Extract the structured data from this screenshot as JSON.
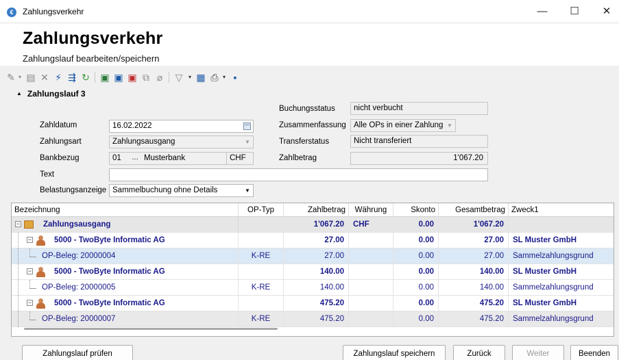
{
  "window": {
    "title": "Zahlungsverkehr",
    "min": "—",
    "max": "☐",
    "close": "✕"
  },
  "header": {
    "title": "Zahlungsverkehr",
    "subtitle": "Zahlungslauf bearbeiten/speichern"
  },
  "toolbar": {
    "icons": [
      "new-icon",
      "edit-icon",
      "delete-icon",
      "flash-icon",
      "split-icon",
      "refresh-icon",
      "export-icon",
      "export2-icon",
      "export-red-icon",
      "copy-icon",
      "erase-icon",
      "filter-icon",
      "filter-dropdown-icon",
      "doc-icon",
      "print-icon",
      "print-dropdown-icon",
      "save-icon"
    ]
  },
  "group": {
    "title": "Zahlungslauf 3"
  },
  "form": {
    "zahldatum_label": "Zahldatum",
    "zahldatum": "16.02.2022",
    "zahlungsart_label": "Zahlungsart",
    "zahlungsart": "Zahlungsausgang",
    "bankbezug_label": "Bankbezug",
    "bank_nr": "01",
    "bank_btn": "...",
    "bank_name": "Musterbank",
    "bank_cur": "CHF",
    "text_label": "Text",
    "text": "",
    "belastung_label": "Belastungsanzeige",
    "belastung": "Sammelbuchung ohne Details",
    "buchungsstatus_label": "Buchungsstatus",
    "buchungsstatus": "nicht verbucht",
    "zusammenfassung_label": "Zusammenfassung",
    "zusammenfassung": "Alle OPs in einer Zahlung",
    "transferstatus_label": "Transferstatus",
    "transferstatus": "Nicht transferiert",
    "zahlbetrag_label": "Zahlbetrag",
    "zahlbetrag": "1'067.20"
  },
  "grid": {
    "headers": {
      "bezeichnung": "Bezeichnung",
      "optyp": "OP-Typ",
      "zahlbetrag": "Zahlbetrag",
      "waehrung": "Währung",
      "skonto": "Skonto",
      "gesamt": "Gesamtbetrag",
      "zweck": "Zweck1"
    },
    "total": {
      "name": "Zahlungsausgang",
      "zahlbetrag": "1'067.20",
      "waehrung": "CHF",
      "skonto": "0.00",
      "gesamt": "1'067.20"
    },
    "rows": [
      {
        "name": "5000 - TwoByte Informatic AG",
        "zahlbetrag": "27.00",
        "skonto": "0.00",
        "gesamt": "27.00",
        "zweck": "SL Muster GmbH"
      },
      {
        "name": "OP-Beleg: 20000004",
        "optyp": "K-RE",
        "zahlbetrag": "27.00",
        "skonto": "0.00",
        "gesamt": "27.00",
        "zweck": "Sammelzahlungsgrund"
      },
      {
        "name": "5000 - TwoByte Informatic AG",
        "zahlbetrag": "140.00",
        "skonto": "0.00",
        "gesamt": "140.00",
        "zweck": "SL Muster GmbH"
      },
      {
        "name": "OP-Beleg: 20000005",
        "optyp": "K-RE",
        "zahlbetrag": "140.00",
        "skonto": "0.00",
        "gesamt": "140.00",
        "zweck": "Sammelzahlungsgrund"
      },
      {
        "name": "5000 - TwoByte Informatic AG",
        "zahlbetrag": "475.20",
        "skonto": "0.00",
        "gesamt": "475.20",
        "zweck": "SL Muster GmbH"
      },
      {
        "name": "OP-Beleg: 20000007",
        "optyp": "K-RE",
        "zahlbetrag": "475.20",
        "skonto": "0.00",
        "gesamt": "475.20",
        "zweck": "Sammelzahlungsgrund"
      }
    ]
  },
  "buttons": {
    "pruefen": "Zahlungslauf prüfen",
    "speichern": "Zahlungslauf speichern",
    "zurueck": "Zurück",
    "weiter": "Weiter",
    "beenden": "Beenden"
  }
}
